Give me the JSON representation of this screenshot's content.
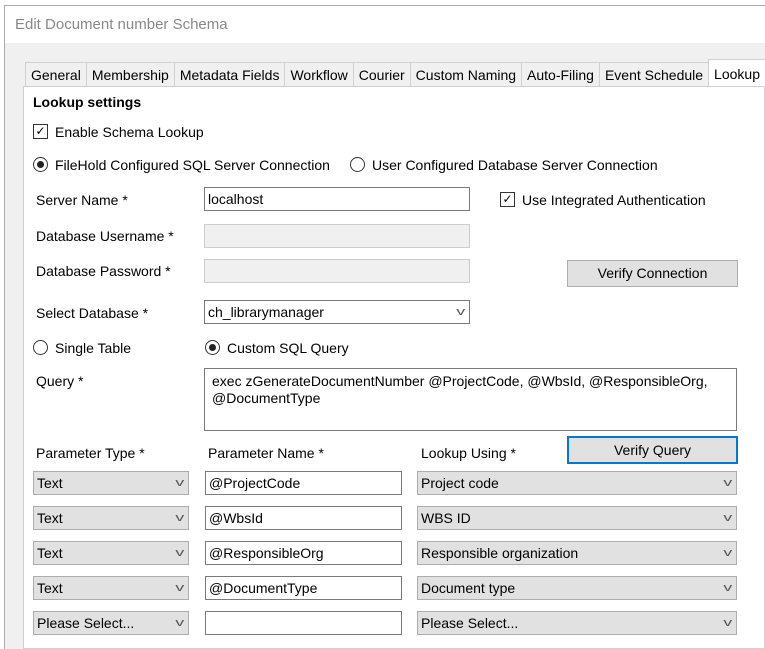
{
  "window": {
    "title": "Edit Document number Schema"
  },
  "tabs": [
    "General",
    "Membership",
    "Metadata Fields",
    "Workflow",
    "Courier",
    "Custom Naming",
    "Auto-Filing",
    "Event Schedule",
    "Lookup"
  ],
  "section_title": "Lookup settings",
  "enable_lookup": {
    "label": "Enable Schema Lookup",
    "checked": true
  },
  "connection": {
    "option1": "FileHold Configured SQL Server Connection",
    "option2": "User Configured Database Server Connection",
    "selected": "option1"
  },
  "server_name": {
    "label": "Server Name *",
    "value": "localhost"
  },
  "integrated_auth": {
    "label": "Use Integrated Authentication",
    "checked": true
  },
  "db_username": {
    "label": "Database Username *",
    "value": ""
  },
  "db_password": {
    "label": "Database Password *",
    "value": ""
  },
  "verify_connection": "Verify Connection",
  "select_database": {
    "label": "Select Database *",
    "value": "ch_librarymanager"
  },
  "query_mode": {
    "option1": "Single Table",
    "option2": "Custom SQL Query",
    "selected": "option2"
  },
  "query": {
    "label": "Query *",
    "value": "exec zGenerateDocumentNumber @ProjectCode, @WbsId, @ResponsibleOrg, @DocumentType"
  },
  "params": {
    "headers": {
      "type": "Parameter Type *",
      "name": "Parameter Name *",
      "lookup": "Lookup Using *"
    },
    "verify_query": "Verify Query",
    "rows": [
      {
        "type": "Text",
        "name": "@ProjectCode",
        "lookup": "Project code"
      },
      {
        "type": "Text",
        "name": "@WbsId",
        "lookup": "WBS ID"
      },
      {
        "type": "Text",
        "name": "@ResponsibleOrg",
        "lookup": "Responsible organization"
      },
      {
        "type": "Text",
        "name": "@DocumentType",
        "lookup": "Document type"
      },
      {
        "type": "Please Select...",
        "name": "",
        "lookup": "Please Select..."
      }
    ]
  }
}
